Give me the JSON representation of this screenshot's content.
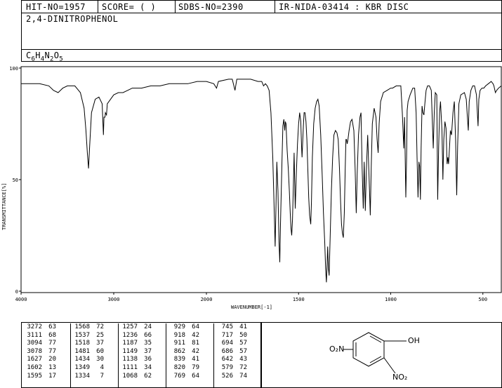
{
  "header": {
    "hit_no": "HIT-NO=1957",
    "score": "SCORE=  (   )",
    "sdbs_no": "SDBS-NO=2390",
    "ir_code": "IR-NIDA-03414 : KBR DISC"
  },
  "compound": {
    "name": "2,4-DINITROPHENOL",
    "formula_parts": [
      "C",
      "6",
      "H",
      "4",
      "N",
      "2",
      "O",
      "5"
    ]
  },
  "chart_data": {
    "type": "line",
    "xlabel": "WAVENUMBER[-1]",
    "ylabel": "TRANSMITTANCE[%]",
    "xlim": [
      4000,
      400
    ],
    "ylim": [
      0,
      100
    ],
    "x_ticks": [
      "4000",
      "3000",
      "2000",
      "1500",
      "1000",
      "500"
    ],
    "y_ticks": [
      "100",
      "50",
      "0"
    ],
    "grid": false,
    "series": [
      {
        "points": [
          [
            4000,
            93
          ],
          [
            3800,
            93
          ],
          [
            3700,
            92
          ],
          [
            3650,
            90
          ],
          [
            3600,
            89
          ],
          [
            3550,
            91
          ],
          [
            3500,
            92
          ],
          [
            3420,
            92
          ],
          [
            3360,
            89
          ],
          [
            3320,
            82
          ],
          [
            3300,
            72
          ],
          [
            3285,
            62
          ],
          [
            3272,
            55
          ],
          [
            3260,
            65
          ],
          [
            3240,
            80
          ],
          [
            3200,
            86
          ],
          [
            3160,
            87
          ],
          [
            3125,
            84
          ],
          [
            3111,
            70
          ],
          [
            3105,
            78
          ],
          [
            3094,
            78
          ],
          [
            3090,
            80
          ],
          [
            3078,
            79
          ],
          [
            3070,
            84
          ],
          [
            3000,
            88
          ],
          [
            2950,
            89
          ],
          [
            2900,
            89
          ],
          [
            2850,
            90
          ],
          [
            2800,
            91
          ],
          [
            2750,
            91
          ],
          [
            2700,
            91
          ],
          [
            2600,
            92
          ],
          [
            2500,
            92
          ],
          [
            2400,
            93
          ],
          [
            2300,
            93
          ],
          [
            2200,
            93
          ],
          [
            2100,
            94
          ],
          [
            2000,
            94
          ],
          [
            1960,
            93
          ],
          [
            1945,
            91
          ],
          [
            1935,
            94
          ],
          [
            1880,
            95
          ],
          [
            1860,
            95
          ],
          [
            1845,
            90
          ],
          [
            1835,
            95
          ],
          [
            1800,
            95
          ],
          [
            1760,
            95
          ],
          [
            1720,
            94
          ],
          [
            1700,
            94
          ],
          [
            1690,
            92
          ],
          [
            1680,
            93
          ],
          [
            1670,
            92
          ],
          [
            1660,
            90
          ],
          [
            1650,
            80
          ],
          [
            1640,
            60
          ],
          [
            1635,
            45
          ],
          [
            1627,
            20
          ],
          [
            1622,
            40
          ],
          [
            1618,
            58
          ],
          [
            1612,
            45
          ],
          [
            1606,
            22
          ],
          [
            1602,
            13
          ],
          [
            1598,
            30
          ],
          [
            1590,
            58
          ],
          [
            1585,
            74
          ],
          [
            1580,
            77
          ],
          [
            1575,
            72
          ],
          [
            1572,
            76
          ],
          [
            1568,
            75
          ],
          [
            1566,
            71
          ],
          [
            1562,
            63
          ],
          [
            1556,
            55
          ],
          [
            1550,
            45
          ],
          [
            1545,
            35
          ],
          [
            1541,
            28
          ],
          [
            1537,
            25
          ],
          [
            1533,
            32
          ],
          [
            1528,
            48
          ],
          [
            1524,
            62
          ],
          [
            1518,
            37
          ],
          [
            1512,
            53
          ],
          [
            1506,
            66
          ],
          [
            1500,
            75
          ],
          [
            1494,
            80
          ],
          [
            1488,
            76
          ],
          [
            1484,
            65
          ],
          [
            1481,
            60
          ],
          [
            1478,
            66
          ],
          [
            1474,
            74
          ],
          [
            1470,
            80
          ],
          [
            1465,
            80
          ],
          [
            1460,
            76
          ],
          [
            1455,
            68
          ],
          [
            1450,
            55
          ],
          [
            1445,
            42
          ],
          [
            1440,
            34
          ],
          [
            1434,
            30
          ],
          [
            1430,
            40
          ],
          [
            1425,
            60
          ],
          [
            1418,
            75
          ],
          [
            1410,
            82
          ],
          [
            1402,
            85
          ],
          [
            1395,
            86
          ],
          [
            1388,
            83
          ],
          [
            1380,
            70
          ],
          [
            1372,
            52
          ],
          [
            1365,
            35
          ],
          [
            1358,
            22
          ],
          [
            1353,
            10
          ],
          [
            1349,
            4
          ],
          [
            1345,
            12
          ],
          [
            1342,
            20
          ],
          [
            1338,
            10
          ],
          [
            1334,
            7
          ],
          [
            1330,
            20
          ],
          [
            1322,
            45
          ],
          [
            1315,
            60
          ],
          [
            1308,
            70
          ],
          [
            1300,
            72
          ],
          [
            1292,
            71
          ],
          [
            1285,
            68
          ],
          [
            1278,
            55
          ],
          [
            1272,
            40
          ],
          [
            1267,
            30
          ],
          [
            1262,
            26
          ],
          [
            1257,
            24
          ],
          [
            1252,
            35
          ],
          [
            1247,
            55
          ],
          [
            1243,
            68
          ],
          [
            1240,
            68
          ],
          [
            1236,
            66
          ],
          [
            1232,
            68
          ],
          [
            1226,
            72
          ],
          [
            1218,
            76
          ],
          [
            1210,
            77
          ],
          [
            1200,
            72
          ],
          [
            1193,
            55
          ],
          [
            1187,
            35
          ],
          [
            1182,
            52
          ],
          [
            1175,
            70
          ],
          [
            1167,
            78
          ],
          [
            1161,
            80
          ],
          [
            1155,
            55
          ],
          [
            1149,
            37
          ],
          [
            1144,
            58
          ],
          [
            1138,
            36
          ],
          [
            1132,
            55
          ],
          [
            1125,
            70
          ],
          [
            1115,
            45
          ],
          [
            1111,
            34
          ],
          [
            1106,
            55
          ],
          [
            1100,
            75
          ],
          [
            1090,
            82
          ],
          [
            1080,
            78
          ],
          [
            1074,
            68
          ],
          [
            1068,
            62
          ],
          [
            1063,
            75
          ],
          [
            1055,
            85
          ],
          [
            1040,
            89
          ],
          [
            1020,
            90
          ],
          [
            1000,
            91
          ],
          [
            990,
            91
          ],
          [
            970,
            92
          ],
          [
            960,
            92
          ],
          [
            945,
            92
          ],
          [
            937,
            80
          ],
          [
            929,
            64
          ],
          [
            925,
            78
          ],
          [
            922,
            62
          ],
          [
            918,
            42
          ],
          [
            914,
            60
          ],
          [
            911,
            81
          ],
          [
            906,
            85
          ],
          [
            895,
            88
          ],
          [
            880,
            91
          ],
          [
            870,
            91
          ],
          [
            862,
            80
          ],
          [
            857,
            60
          ],
          [
            852,
            42
          ],
          [
            847,
            58
          ],
          [
            843,
            56
          ],
          [
            839,
            41
          ],
          [
            835,
            64
          ],
          [
            830,
            83
          ],
          [
            825,
            80
          ],
          [
            820,
            79
          ],
          [
            815,
            84
          ],
          [
            808,
            90
          ],
          [
            800,
            92
          ],
          [
            790,
            92
          ],
          [
            780,
            90
          ],
          [
            774,
            76
          ],
          [
            769,
            64
          ],
          [
            764,
            80
          ],
          [
            758,
            89
          ],
          [
            750,
            88
          ],
          [
            745,
            41
          ],
          [
            740,
            65
          ],
          [
            735,
            80
          ],
          [
            730,
            85
          ],
          [
            722,
            72
          ],
          [
            717,
            50
          ],
          [
            712,
            68
          ],
          [
            706,
            76
          ],
          [
            700,
            73
          ],
          [
            694,
            57
          ],
          [
            690,
            60
          ],
          [
            686,
            57
          ],
          [
            680,
            66
          ],
          [
            676,
            72
          ],
          [
            670,
            70
          ],
          [
            662,
            80
          ],
          [
            655,
            85
          ],
          [
            648,
            68
          ],
          [
            642,
            43
          ],
          [
            637,
            65
          ],
          [
            630,
            84
          ],
          [
            620,
            88
          ],
          [
            600,
            89
          ],
          [
            590,
            86
          ],
          [
            584,
            78
          ],
          [
            579,
            72
          ],
          [
            574,
            85
          ],
          [
            565,
            90
          ],
          [
            555,
            92
          ],
          [
            545,
            92
          ],
          [
            535,
            88
          ],
          [
            530,
            80
          ],
          [
            526,
            74
          ],
          [
            522,
            86
          ],
          [
            515,
            90
          ],
          [
            505,
            91
          ],
          [
            495,
            91
          ],
          [
            485,
            92
          ],
          [
            470,
            93
          ],
          [
            455,
            94
          ],
          [
            445,
            93
          ],
          [
            440,
            92
          ],
          [
            432,
            89
          ],
          [
            425,
            90
          ],
          [
            415,
            91
          ],
          [
            400,
            92
          ]
        ]
      }
    ]
  },
  "peaks": {
    "col1": [
      [
        "3272",
        "63"
      ],
      [
        "3111",
        "68"
      ],
      [
        "3094",
        "77"
      ],
      [
        "3078",
        "77"
      ],
      [
        "1627",
        "20"
      ],
      [
        "1602",
        "13"
      ],
      [
        "1595",
        "17"
      ]
    ],
    "col2": [
      [
        "1568",
        "72"
      ],
      [
        "1537",
        "25"
      ],
      [
        "1518",
        "37"
      ],
      [
        "1481",
        "60"
      ],
      [
        "1434",
        "30"
      ],
      [
        "1349",
        "4"
      ],
      [
        "1334",
        "7"
      ]
    ],
    "col3": [
      [
        "1257",
        "24"
      ],
      [
        "1236",
        "66"
      ],
      [
        "1187",
        "35"
      ],
      [
        "1149",
        "37"
      ],
      [
        "1138",
        "36"
      ],
      [
        "1111",
        "34"
      ],
      [
        "1068",
        "62"
      ]
    ],
    "col4": [
      [
        "929",
        "64"
      ],
      [
        "918",
        "42"
      ],
      [
        "911",
        "81"
      ],
      [
        "862",
        "42"
      ],
      [
        "839",
        "41"
      ],
      [
        "820",
        "79"
      ],
      [
        "769",
        "64"
      ]
    ],
    "col5": [
      [
        "745",
        "41"
      ],
      [
        "717",
        "50"
      ],
      [
        "694",
        "57"
      ],
      [
        "686",
        "57"
      ],
      [
        "642",
        "43"
      ],
      [
        "579",
        "72"
      ],
      [
        "526",
        "74"
      ]
    ]
  },
  "structure": {
    "left_group": "O₂N",
    "right_group": "OH",
    "bottom_group": "NO₂"
  }
}
